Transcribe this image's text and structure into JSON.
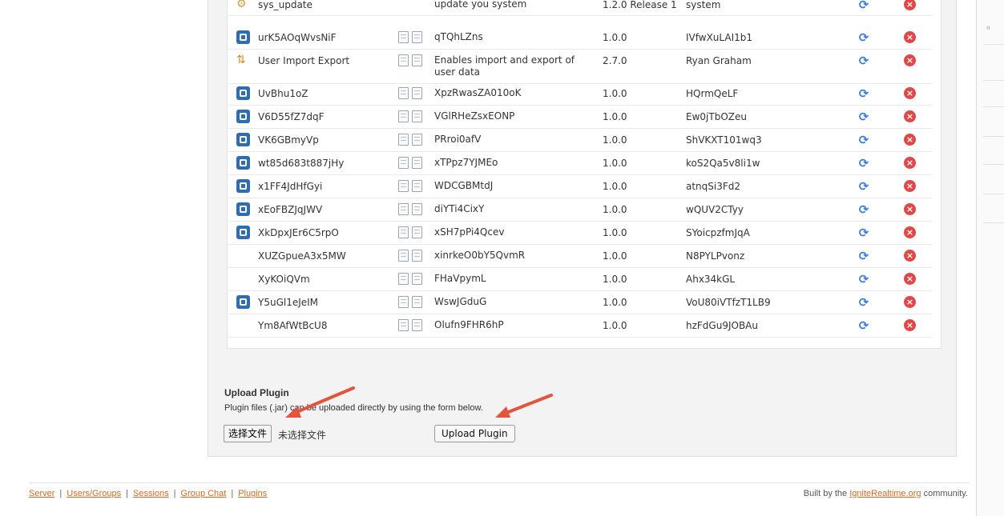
{
  "plugins": [
    {
      "icon": "gear-icon",
      "name": "sys_update",
      "description": "update you system",
      "version": "1.2.0 Release 1",
      "author": "system",
      "docs": false
    },
    {
      "icon": "openfire-logo-icon",
      "name": "urK5AOqWvsNiF",
      "description": "qTQhLZns",
      "version": "1.0.0",
      "author": "IVfwXuLAI1b1",
      "docs": true
    },
    {
      "icon": "user-import-icon",
      "name": "User Import Export",
      "description": "Enables import and export of user data",
      "version": "2.7.0",
      "author": "Ryan Graham",
      "docs": true
    },
    {
      "icon": "openfire-logo-icon",
      "name": "UvBhu1oZ",
      "description": "XpzRwasZA010oK",
      "version": "1.0.0",
      "author": "HQrmQeLF",
      "docs": true
    },
    {
      "icon": "openfire-logo-icon",
      "name": "V6D55fZ7dqF",
      "description": "VGlRHeZsxEONP",
      "version": "1.0.0",
      "author": "Ew0jTbOZeu",
      "docs": true
    },
    {
      "icon": "openfire-logo-icon",
      "name": "VK6GBmyVp",
      "description": "PRroi0afV",
      "version": "1.0.0",
      "author": "ShVKXT101wq3",
      "docs": true
    },
    {
      "icon": "openfire-logo-icon",
      "name": "wt85d683t887jHy",
      "description": "xTPpz7YJMEo",
      "version": "1.0.0",
      "author": "koS2Qa5v8li1w",
      "docs": true
    },
    {
      "icon": "openfire-logo-icon",
      "name": "x1FF4JdHfGyi",
      "description": "WDCGBMtdJ",
      "version": "1.0.0",
      "author": "atnqSi3Fd2",
      "docs": true
    },
    {
      "icon": "openfire-logo-icon",
      "name": "xEoFBZJqJWV",
      "description": "diYTi4CixY",
      "version": "1.0.0",
      "author": "wQUV2CTyy",
      "docs": true
    },
    {
      "icon": "openfire-logo-icon",
      "name": "XkDpxJEr6C5rpO",
      "description": "xSH7pPi4Qcev",
      "version": "1.0.0",
      "author": "SYoicpzfmJqA",
      "docs": true
    },
    {
      "icon": "",
      "name": "XUZGpueA3x5MW",
      "description": "xinrkeO0bY5QvmR",
      "version": "1.0.0",
      "author": "N8PYLPvonz",
      "docs": true
    },
    {
      "icon": "",
      "name": "XyKOiQVm",
      "description": "FHaVpymL",
      "version": "1.0.0",
      "author": "Ahx34kGL",
      "docs": true
    },
    {
      "icon": "openfire-logo-icon",
      "name": "Y5uGl1eJeIM",
      "description": "WswJGduG",
      "version": "1.0.0",
      "author": "VoU80iVTfzT1LB9",
      "docs": true
    },
    {
      "icon": "",
      "name": "Ym8AfWtBcU8",
      "description": "Olufn9FHR6hP",
      "version": "1.0.0",
      "author": "hzFdGu9JOBAu",
      "docs": true
    }
  ],
  "upload": {
    "title": "Upload Plugin",
    "description": "Plugin files (.jar) can be uploaded directly by using the form below.",
    "choose_file_label": "选择文件",
    "no_file_text": "未选择文件",
    "upload_button_label": "Upload Plugin"
  },
  "footer": {
    "links": [
      "Server",
      "Users/Groups",
      "Sessions",
      "Group Chat",
      "Plugins"
    ],
    "credit_prefix": "Built by the",
    "credit_link": "IgniteRealtime.org",
    "credit_suffix": "community."
  },
  "colors": {
    "link": "#d06a28",
    "arrow": "#e2553c",
    "reload": "#3b7dd8",
    "delete": "#e04848"
  }
}
